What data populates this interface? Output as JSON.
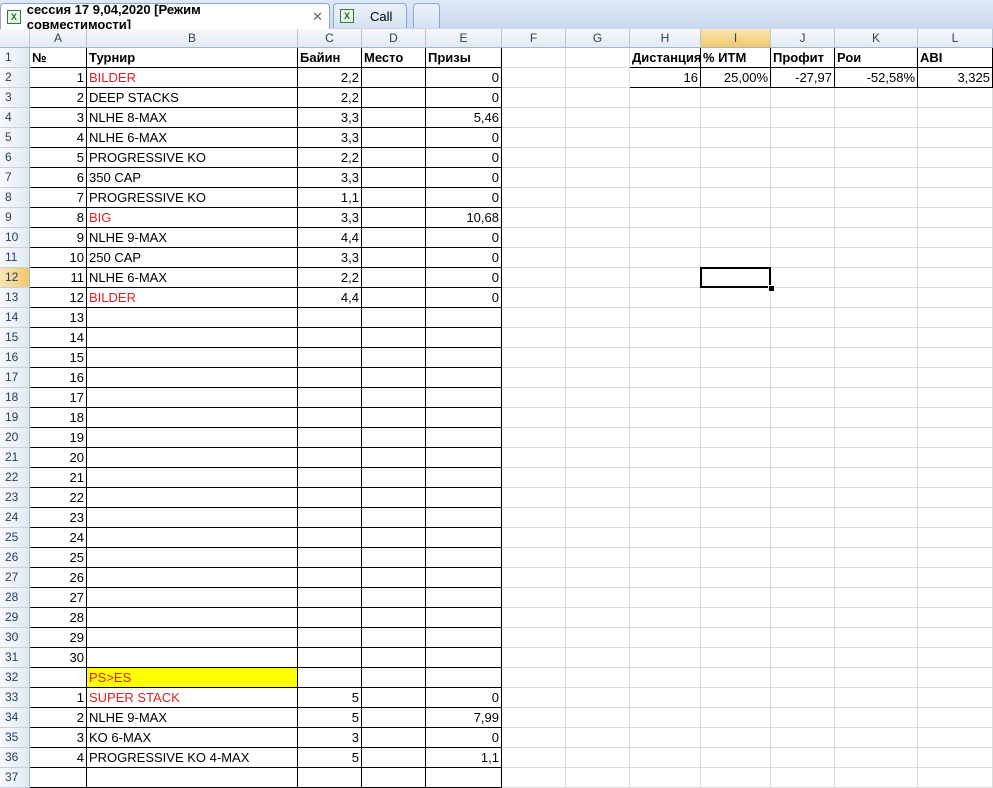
{
  "tabs": [
    {
      "label": "сессия 17 9,04,2020  [Режим совместимости]",
      "active": true,
      "icon": "excel-icon"
    },
    {
      "label": "Call",
      "active": false,
      "icon": "excel-icon"
    },
    {
      "label": "",
      "active": false
    }
  ],
  "columns": [
    "A",
    "B",
    "C",
    "D",
    "E",
    "F",
    "G",
    "H",
    "I",
    "J",
    "K",
    "L"
  ],
  "selected_column": "I",
  "selected_row": 12,
  "rows": [
    "1",
    "2",
    "3",
    "4",
    "5",
    "6",
    "7",
    "8",
    "9",
    "10",
    "11",
    "12",
    "13",
    "14",
    "15",
    "16",
    "17",
    "18",
    "19",
    "20",
    "21",
    "22",
    "23",
    "24",
    "25",
    "26",
    "27",
    "28",
    "29",
    "30",
    "31",
    "32",
    "33",
    "34",
    "35",
    "36",
    "37"
  ],
  "table_headers": {
    "num": "№",
    "tournament": "Турнир",
    "buyin": "Байин",
    "place": "Место",
    "prizes": "Призы"
  },
  "main_table": [
    {
      "n": "1",
      "name": "BILDER",
      "buyin": "2,2",
      "place": "",
      "prize": "0",
      "red": true
    },
    {
      "n": "2",
      "name": "DEEP STACKS",
      "buyin": "2,2",
      "place": "",
      "prize": "0",
      "red": false
    },
    {
      "n": "3",
      "name": "NLHE 8-MAX",
      "buyin": "3,3",
      "place": "",
      "prize": "5,46",
      "red": false
    },
    {
      "n": "4",
      "name": "NLHE 6-MAX",
      "buyin": "3,3",
      "place": "",
      "prize": "0",
      "red": false
    },
    {
      "n": "5",
      "name": "PROGRESSIVE KO",
      "buyin": "2,2",
      "place": "",
      "prize": "0",
      "red": false
    },
    {
      "n": "6",
      "name": "350 CAP",
      "buyin": "3,3",
      "place": "",
      "prize": "0",
      "red": false
    },
    {
      "n": "7",
      "name": "PROGRESSIVE KO",
      "buyin": "1,1",
      "place": "",
      "prize": "0",
      "red": false
    },
    {
      "n": "8",
      "name": "BIG",
      "buyin": "3,3",
      "place": "",
      "prize": "10,68",
      "red": true
    },
    {
      "n": "9",
      "name": "NLHE 9-MAX",
      "buyin": "4,4",
      "place": "",
      "prize": "0",
      "red": false
    },
    {
      "n": "10",
      "name": "250 CAP",
      "buyin": "3,3",
      "place": "",
      "prize": "0",
      "red": false
    },
    {
      "n": "11",
      "name": "NLHE 6-MAX",
      "buyin": "2,2",
      "place": "",
      "prize": "0",
      "red": false
    },
    {
      "n": "12",
      "name": "BILDER",
      "buyin": "4,4",
      "place": "",
      "prize": "0",
      "red": true
    },
    {
      "n": "13",
      "name": "",
      "buyin": "",
      "place": "",
      "prize": "",
      "red": false
    },
    {
      "n": "14",
      "name": "",
      "buyin": "",
      "place": "",
      "prize": "",
      "red": false
    },
    {
      "n": "15",
      "name": "",
      "buyin": "",
      "place": "",
      "prize": "",
      "red": false
    },
    {
      "n": "16",
      "name": "",
      "buyin": "",
      "place": "",
      "prize": "",
      "red": false
    },
    {
      "n": "17",
      "name": "",
      "buyin": "",
      "place": "",
      "prize": "",
      "red": false
    },
    {
      "n": "18",
      "name": "",
      "buyin": "",
      "place": "",
      "prize": "",
      "red": false
    },
    {
      "n": "19",
      "name": "",
      "buyin": "",
      "place": "",
      "prize": "",
      "red": false
    },
    {
      "n": "20",
      "name": "",
      "buyin": "",
      "place": "",
      "prize": "",
      "red": false
    },
    {
      "n": "21",
      "name": "",
      "buyin": "",
      "place": "",
      "prize": "",
      "red": false
    },
    {
      "n": "22",
      "name": "",
      "buyin": "",
      "place": "",
      "prize": "",
      "red": false
    },
    {
      "n": "23",
      "name": "",
      "buyin": "",
      "place": "",
      "prize": "",
      "red": false
    },
    {
      "n": "24",
      "name": "",
      "buyin": "",
      "place": "",
      "prize": "",
      "red": false
    },
    {
      "n": "25",
      "name": "",
      "buyin": "",
      "place": "",
      "prize": "",
      "red": false
    },
    {
      "n": "26",
      "name": "",
      "buyin": "",
      "place": "",
      "prize": "",
      "red": false
    },
    {
      "n": "27",
      "name": "",
      "buyin": "",
      "place": "",
      "prize": "",
      "red": false
    },
    {
      "n": "28",
      "name": "",
      "buyin": "",
      "place": "",
      "prize": "",
      "red": false
    },
    {
      "n": "29",
      "name": "",
      "buyin": "",
      "place": "",
      "prize": "",
      "red": false
    },
    {
      "n": "30",
      "name": "",
      "buyin": "",
      "place": "",
      "prize": "",
      "red": false
    }
  ],
  "section_label": "PS>ES",
  "section_table": [
    {
      "n": "1",
      "name": "SUPER STACK",
      "buyin": "5",
      "place": "",
      "prize": "0",
      "red": true
    },
    {
      "n": "2",
      "name": "NLHE 9-MAX",
      "buyin": "5",
      "place": "",
      "prize": "7,99",
      "red": false
    },
    {
      "n": "3",
      "name": "KO 6-MAX",
      "buyin": "3",
      "place": "",
      "prize": "0",
      "red": false
    },
    {
      "n": "4",
      "name": "PROGRESSIVE KO 4-MAX",
      "buyin": "5",
      "place": "",
      "prize": "1,1",
      "red": false
    }
  ],
  "stats": {
    "headers": [
      "Дистанция",
      "% ИТМ",
      "Профит",
      "Рои",
      "ABI"
    ],
    "values": [
      "16",
      "25,00%",
      "-27,97",
      "-52,58%",
      "3,325"
    ]
  },
  "colors": {
    "red_text": "#e02020",
    "highlight": "#ffff00",
    "header_selected": "#f1c86a"
  }
}
